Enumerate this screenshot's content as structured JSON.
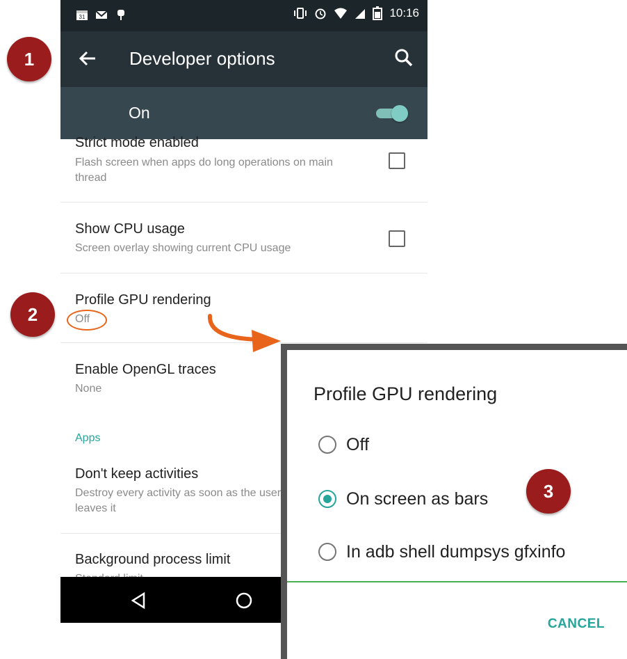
{
  "status_bar": {
    "time": "10:16",
    "left_icons": [
      "calendar-icon",
      "gmail-icon",
      "android-debug-icon"
    ],
    "right_icons": [
      "vibrate-icon",
      "alarm-icon",
      "wifi-icon",
      "signal-icon",
      "battery-icon"
    ]
  },
  "app_bar": {
    "title": "Developer options"
  },
  "master_toggle": {
    "label": "On",
    "state": "on"
  },
  "settings": [
    {
      "title": "Strict mode enabled",
      "summary": "Flash screen when apps do long operations on main thread",
      "checkbox": false
    },
    {
      "title": "Show CPU usage",
      "summary": "Screen overlay showing current CPU usage",
      "checkbox": false
    },
    {
      "title": "Profile GPU rendering",
      "summary": "Off"
    },
    {
      "title": "Enable OpenGL traces",
      "summary": "None"
    }
  ],
  "apps_section": {
    "header": "Apps",
    "items": [
      {
        "title": "Don't keep activities",
        "summary": "Destroy every activity as soon as the user leaves it"
      },
      {
        "title": "Background process limit",
        "summary": "Standard limit"
      }
    ]
  },
  "dialog": {
    "title": "Profile GPU rendering",
    "options": [
      {
        "label": "Off",
        "selected": false
      },
      {
        "label": "On screen as bars",
        "selected": true
      },
      {
        "label": "In adb shell dumpsys gfxinfo",
        "selected": false
      }
    ],
    "cancel": "CANCEL"
  },
  "annotations": {
    "step1": "1",
    "step2": "2",
    "step3": "3"
  },
  "colors": {
    "accent": "#26a69a",
    "badge": "#9b1c1c",
    "highlight": "#e8641b",
    "toolbar": "#263238"
  }
}
